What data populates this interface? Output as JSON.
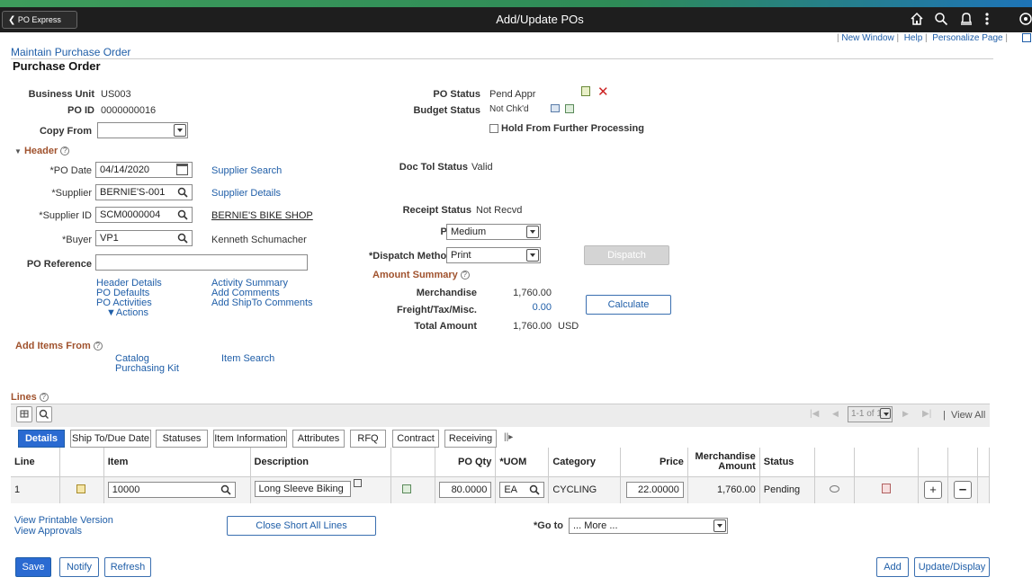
{
  "topbar": {
    "back_label": "PO Express",
    "title": "Add/Update POs"
  },
  "utility_links": [
    "New Window",
    "Help",
    "Personalize Page"
  ],
  "breadcrumb": "Maintain Purchase Order",
  "page_title": "Purchase Order",
  "po_info": {
    "business_unit_label": "Business Unit",
    "business_unit": "US003",
    "po_id_label": "PO ID",
    "po_id": "0000000016",
    "copy_from_label": "Copy From",
    "po_status_label": "PO Status",
    "po_status": "Pend Appr",
    "budget_status_label": "Budget Status",
    "budget_status": "Not Chk'd",
    "hold_label": "Hold From Further Processing"
  },
  "header": {
    "section_label": "Header",
    "po_date_label": "*PO Date",
    "po_date": "04/14/2020",
    "supplier_search": "Supplier Search",
    "supplier_label": "*Supplier",
    "supplier": "BERNIE'S-001",
    "supplier_details": "Supplier Details",
    "supplier_id_label": "*Supplier ID",
    "supplier_id": "SCM0000004",
    "supplier_name": "BERNIE'S BIKE SHOP",
    "buyer_label": "*Buyer",
    "buyer": "VP1",
    "buyer_name": "Kenneth Schumacher",
    "po_reference_label": "PO Reference",
    "links_col1": [
      "Header Details",
      "PO Defaults",
      "PO Activities"
    ],
    "actions_label": "▼Actions",
    "links_col2": [
      "Activity Summary",
      "Add Comments",
      "Add ShipTo Comments"
    ],
    "doc_tol_label": "Doc Tol Status",
    "doc_tol": "Valid",
    "receipt_label": "Receipt Status",
    "receipt": "Not Recvd",
    "priority_label": "Priority",
    "priority": "Medium",
    "dispatch_method_label": "*Dispatch Method",
    "dispatch_method": "Print",
    "dispatch_button": "Dispatch"
  },
  "amount_summary": {
    "title": "Amount Summary",
    "merchandise_label": "Merchandise",
    "merchandise": "1,760.00",
    "freight_label": "Freight/Tax/Misc.",
    "freight": "0.00",
    "total_label": "Total Amount",
    "total": "1,760.00",
    "currency": "USD",
    "calculate_button": "Calculate"
  },
  "add_items": {
    "title": "Add Items From",
    "catalog": "Catalog",
    "purchasing_kit": "Purchasing Kit",
    "item_search": "Item Search"
  },
  "lines": {
    "title": "Lines",
    "pager": "1-1 of 1",
    "view_all": "View All",
    "tabs": [
      "Details",
      "Ship To/Due Date",
      "Statuses",
      "Item Information",
      "Attributes",
      "RFQ",
      "Contract",
      "Receiving"
    ],
    "columns": {
      "line": "Line",
      "item": "Item",
      "description": "Description",
      "po_qty": "PO Qty",
      "uom": "*UOM",
      "category": "Category",
      "price": "Price",
      "merch_amount": "Merchandise Amount",
      "status": "Status"
    },
    "rows": [
      {
        "line": "1",
        "item": "10000",
        "description": "Long Sleeve Biking",
        "po_qty": "80.0000",
        "uom": "EA",
        "category": "CYCLING",
        "price": "22.00000",
        "merch_amount": "1,760.00",
        "status": "Pending"
      }
    ]
  },
  "footer": {
    "view_printable": "View Printable Version",
    "view_approvals": "View Approvals",
    "close_short": "Close Short All Lines",
    "goto_label": "*Go to",
    "goto_value": "... More ...",
    "save": "Save",
    "notify": "Notify",
    "refresh": "Refresh",
    "add": "Add",
    "update_display": "Update/Display"
  },
  "colors": {
    "topbar_bg": "#1e1e1e",
    "topbar_accent": "#2e8b57",
    "primary_button": "#2a6ad1",
    "link": "#1f5ea8",
    "section_title": "#a0522d",
    "delete_x": "#cc2222"
  }
}
